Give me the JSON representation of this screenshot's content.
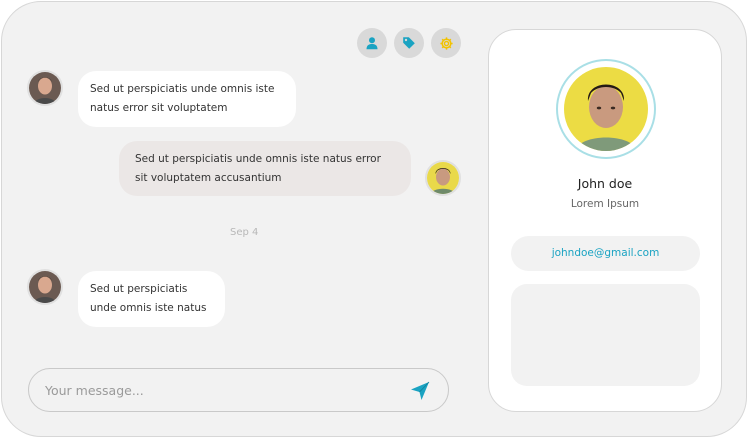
{
  "colors": {
    "accent": "#1aa3c2",
    "gear": "#f2c200",
    "surface": "#f2f2f2",
    "bubble_in": "#ffffff",
    "bubble_out": "#ebe7e6"
  },
  "toolbar": {
    "icons": [
      "user-icon",
      "tag-icon",
      "gear-icon"
    ]
  },
  "messages": [
    {
      "direction": "incoming",
      "avatar": "contact-avatar",
      "lines": [
        "Sed ut perspiciatis unde omnis iste",
        "natus error sit voluptatem"
      ]
    },
    {
      "direction": "outgoing",
      "avatar": "user-avatar",
      "lines": [
        "Sed ut perspiciatis unde omnis iste natus error",
        "sit voluptatem accusantium"
      ]
    },
    {
      "direction": "incoming",
      "avatar": "contact-avatar",
      "lines": [
        "Sed ut perspiciatis",
        "unde omnis iste natus"
      ]
    }
  ],
  "date_separator": "Sep 4",
  "composer": {
    "placeholder": "Your message...",
    "send_icon": "send-icon"
  },
  "profile": {
    "name": "John doe",
    "subtitle": "Lorem Ipsum",
    "email": "johndoe@gmail.com"
  }
}
